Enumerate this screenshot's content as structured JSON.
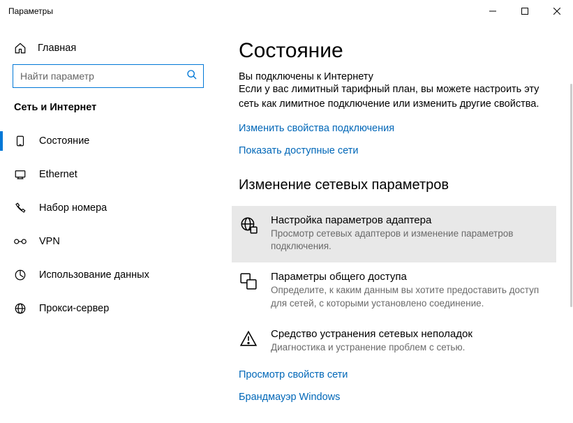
{
  "window": {
    "title": "Параметры"
  },
  "sidebar": {
    "home_label": "Главная",
    "search_placeholder": "Найти параметр",
    "section_title": "Сеть и Интернет",
    "items": [
      {
        "label": "Состояние",
        "icon": "status-icon",
        "active": true
      },
      {
        "label": "Ethernet",
        "icon": "ethernet-icon",
        "active": false
      },
      {
        "label": "Набор номера",
        "icon": "dialup-icon",
        "active": false
      },
      {
        "label": "VPN",
        "icon": "vpn-icon",
        "active": false
      },
      {
        "label": "Использование данных",
        "icon": "data-icon",
        "active": false
      },
      {
        "label": "Прокси-сервер",
        "icon": "proxy-icon",
        "active": false
      }
    ]
  },
  "main": {
    "heading": "Состояние",
    "cut_line": "Вы подключены к Интернету",
    "intro": "Если у вас лимитный тарифный план, вы можете настроить эту сеть как лимитное подключение или изменить другие свойства.",
    "link_change": "Изменить свойства подключения",
    "link_show": "Показать доступные сети",
    "change_heading": "Изменение сетевых параметров",
    "options": [
      {
        "title": "Настройка параметров адаптера",
        "desc": "Просмотр сетевых адаптеров и изменение параметров подключения.",
        "icon": "adapter-icon",
        "hover": true
      },
      {
        "title": "Параметры общего доступа",
        "desc": "Определите, к каким данным вы хотите предоставить доступ для сетей, с которыми установлено соединение.",
        "icon": "sharing-icon",
        "hover": false
      },
      {
        "title": "Средство устранения сетевых неполадок",
        "desc": "Диагностика и устранение проблем с сетью.",
        "icon": "troubleshoot-icon",
        "hover": false
      }
    ],
    "link_props": "Просмотр свойств сети",
    "link_firewall": "Брандмауэр Windows"
  }
}
